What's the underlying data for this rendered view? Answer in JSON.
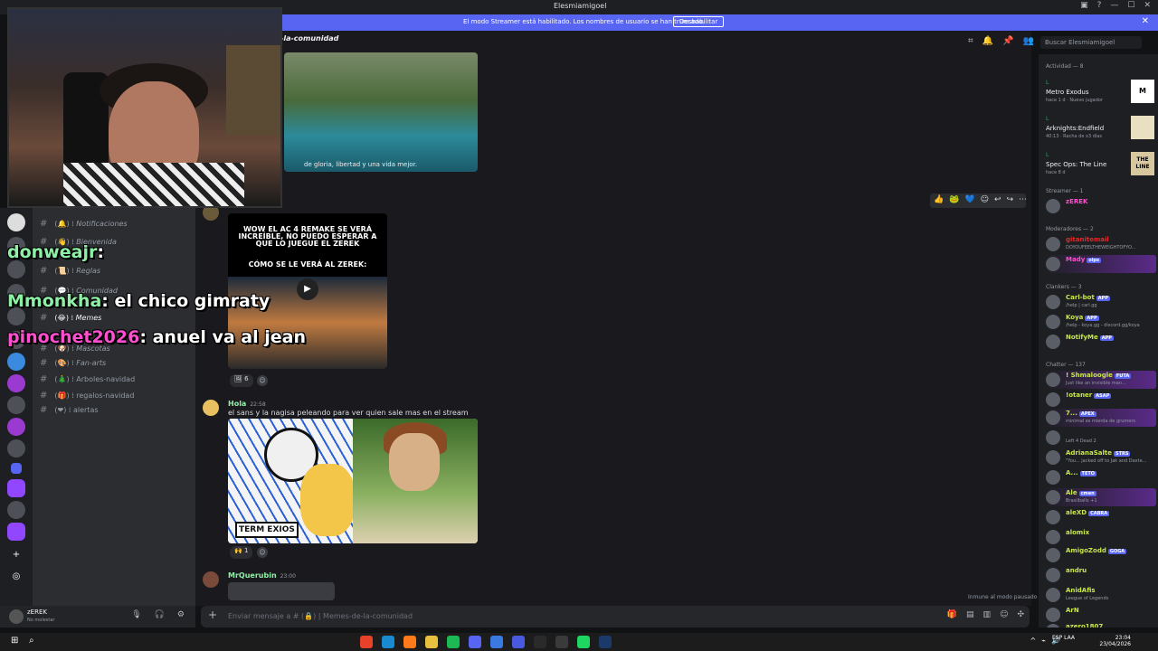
{
  "window": {
    "title": "Elesmiamigoel"
  },
  "streamer_bar": {
    "message": "El modo Streamer está habilitado. Los nombres de usuario se han truncado.",
    "button": "Deshabilitar"
  },
  "channel": {
    "name": "-la-comunidad",
    "search_placeholder": "Buscar Elesmiamigoel"
  },
  "channels": [
    {
      "emoji": "🔔",
      "label": "Notificaciones"
    },
    {
      "emoji": "👋",
      "label": "Bienvenida"
    },
    {
      "emoji": "📜",
      "label": "Reglas"
    },
    {
      "emoji": "💬",
      "label": "Comunidad"
    },
    {
      "emoji": "😂",
      "label": "Memes"
    },
    {
      "emoji": "🐶",
      "label": "Mascotas"
    },
    {
      "emoji": "🎨",
      "label": "Fan-arts"
    },
    {
      "emoji": "🎄",
      "label": "Arboles-navidad"
    },
    {
      "emoji": "🎁",
      "label": "regalos-navidad"
    },
    {
      "emoji": "❤",
      "label": "alertas"
    }
  ],
  "overlay_chat": [
    {
      "user": "donweajr",
      "text": ""
    },
    {
      "user": "Mmonkha",
      "text": "el chico gimraty"
    },
    {
      "user": "pinochet2026",
      "text": "anuel va al jean"
    }
  ],
  "messages": {
    "island_caption": "de gloria, libertad y una vida mejor.",
    "ac_title": "WOW EL AC 4 REMAKE SE VERÁ INCREÍBLE, NO PUEDO ESPERAR A QUE LO JUEGUE EL ZEREK",
    "ac_subtitle": "CÓMO SE LE VERÁ AL ZEREK:",
    "reaction_1_count": "6",
    "hola_author": "Hola",
    "hola_time": "22:58",
    "hola_text": "el sans y la nagisa peleando para ver quien sale mas en el stream",
    "sans_logo": "TERM EXIOS",
    "reaction_2_count": "1",
    "querubin_author": "MrQuerubin",
    "querubin_time": "23:00"
  },
  "composer": {
    "placeholder": "Enviar mensaje a # (🔒) | Memes-de-la-comunidad"
  },
  "slowmode": "Inmune al modo pausado",
  "user_panel": {
    "name": "zEREK",
    "status": "No molestar"
  },
  "members": {
    "activity_header": "Actividad — 8",
    "activities": [
      {
        "label": "L",
        "game": "Metro Exodus",
        "sub": "hace 1 d · Nuevo jugador",
        "thumb": "M"
      },
      {
        "label": "L",
        "game": "Arknights:Endfield",
        "sub": "40:13 · Racha de x3 días",
        "thumb": ""
      },
      {
        "label": "L",
        "game": "Spec Ops: The Line",
        "sub": "hace 8 d",
        "thumb": "THE LINE"
      }
    ],
    "streamer_header": "Streamer — 1",
    "streamer": [
      {
        "name": "zEREK",
        "sub": ""
      }
    ],
    "mod_header": "Moderadores — 2",
    "mods": [
      {
        "name": "gitanitemail",
        "sub": "DOYOUFEELTHEWEIGHTOFYO..."
      },
      {
        "name": "Mady",
        "sub": "",
        "tag": "olps"
      }
    ],
    "clankers_header": "Clankers — 3",
    "clankers": [
      {
        "name": "Carl-bot",
        "sub": "/help | carl.gg",
        "tag": "APP"
      },
      {
        "name": "Koya",
        "sub": "/help - koya.gg - discord.gg/koya",
        "tag": "APP"
      },
      {
        "name": "NotifyMe",
        "sub": "",
        "tag": "APP"
      }
    ],
    "chatter_header": "Chatter — 137",
    "chatters": [
      {
        "name": "! Shmaloogle",
        "sub": "Just like an invisible man...",
        "tag": "FUTA"
      },
      {
        "name": "!otaner",
        "sub": "",
        "tag": "ASAP"
      },
      {
        "name": "7...",
        "sub": "minimal es mierda de grumers",
        "tag": "APEX"
      },
      {
        "name": "",
        "sub": "Left 4 Dead 2",
        "tag": ""
      },
      {
        "name": "AdrianaSalte",
        "sub": "\"You... jacked off to Jak and Daxte...",
        "tag": "STRS"
      },
      {
        "name": "A...",
        "sub": "",
        "tag": "TETO"
      },
      {
        "name": "Ale",
        "sub": "Brasilballs +1",
        "tag": "cmen"
      },
      {
        "name": "aleXD",
        "sub": "",
        "tag": "CABRA"
      },
      {
        "name": "alomix",
        "sub": "",
        "tag": ""
      },
      {
        "name": "AmigoZodd",
        "sub": "",
        "tag": "GOGA"
      },
      {
        "name": "andru",
        "sub": "",
        "tag": ""
      },
      {
        "name": "AnidAfis",
        "sub": "League of Legends",
        "tag": ""
      },
      {
        "name": "ArN",
        "sub": "",
        "tag": ""
      },
      {
        "name": "azero1807",
        "sub": "",
        "tag": ""
      }
    ]
  },
  "taskbar": {
    "lang": "ESP\nLAA",
    "time": "23:04",
    "date": "23/04/2026"
  },
  "colors": {
    "blurple": "#5865f2",
    "green": "#23a55a",
    "pink": "#ff4fd0"
  }
}
